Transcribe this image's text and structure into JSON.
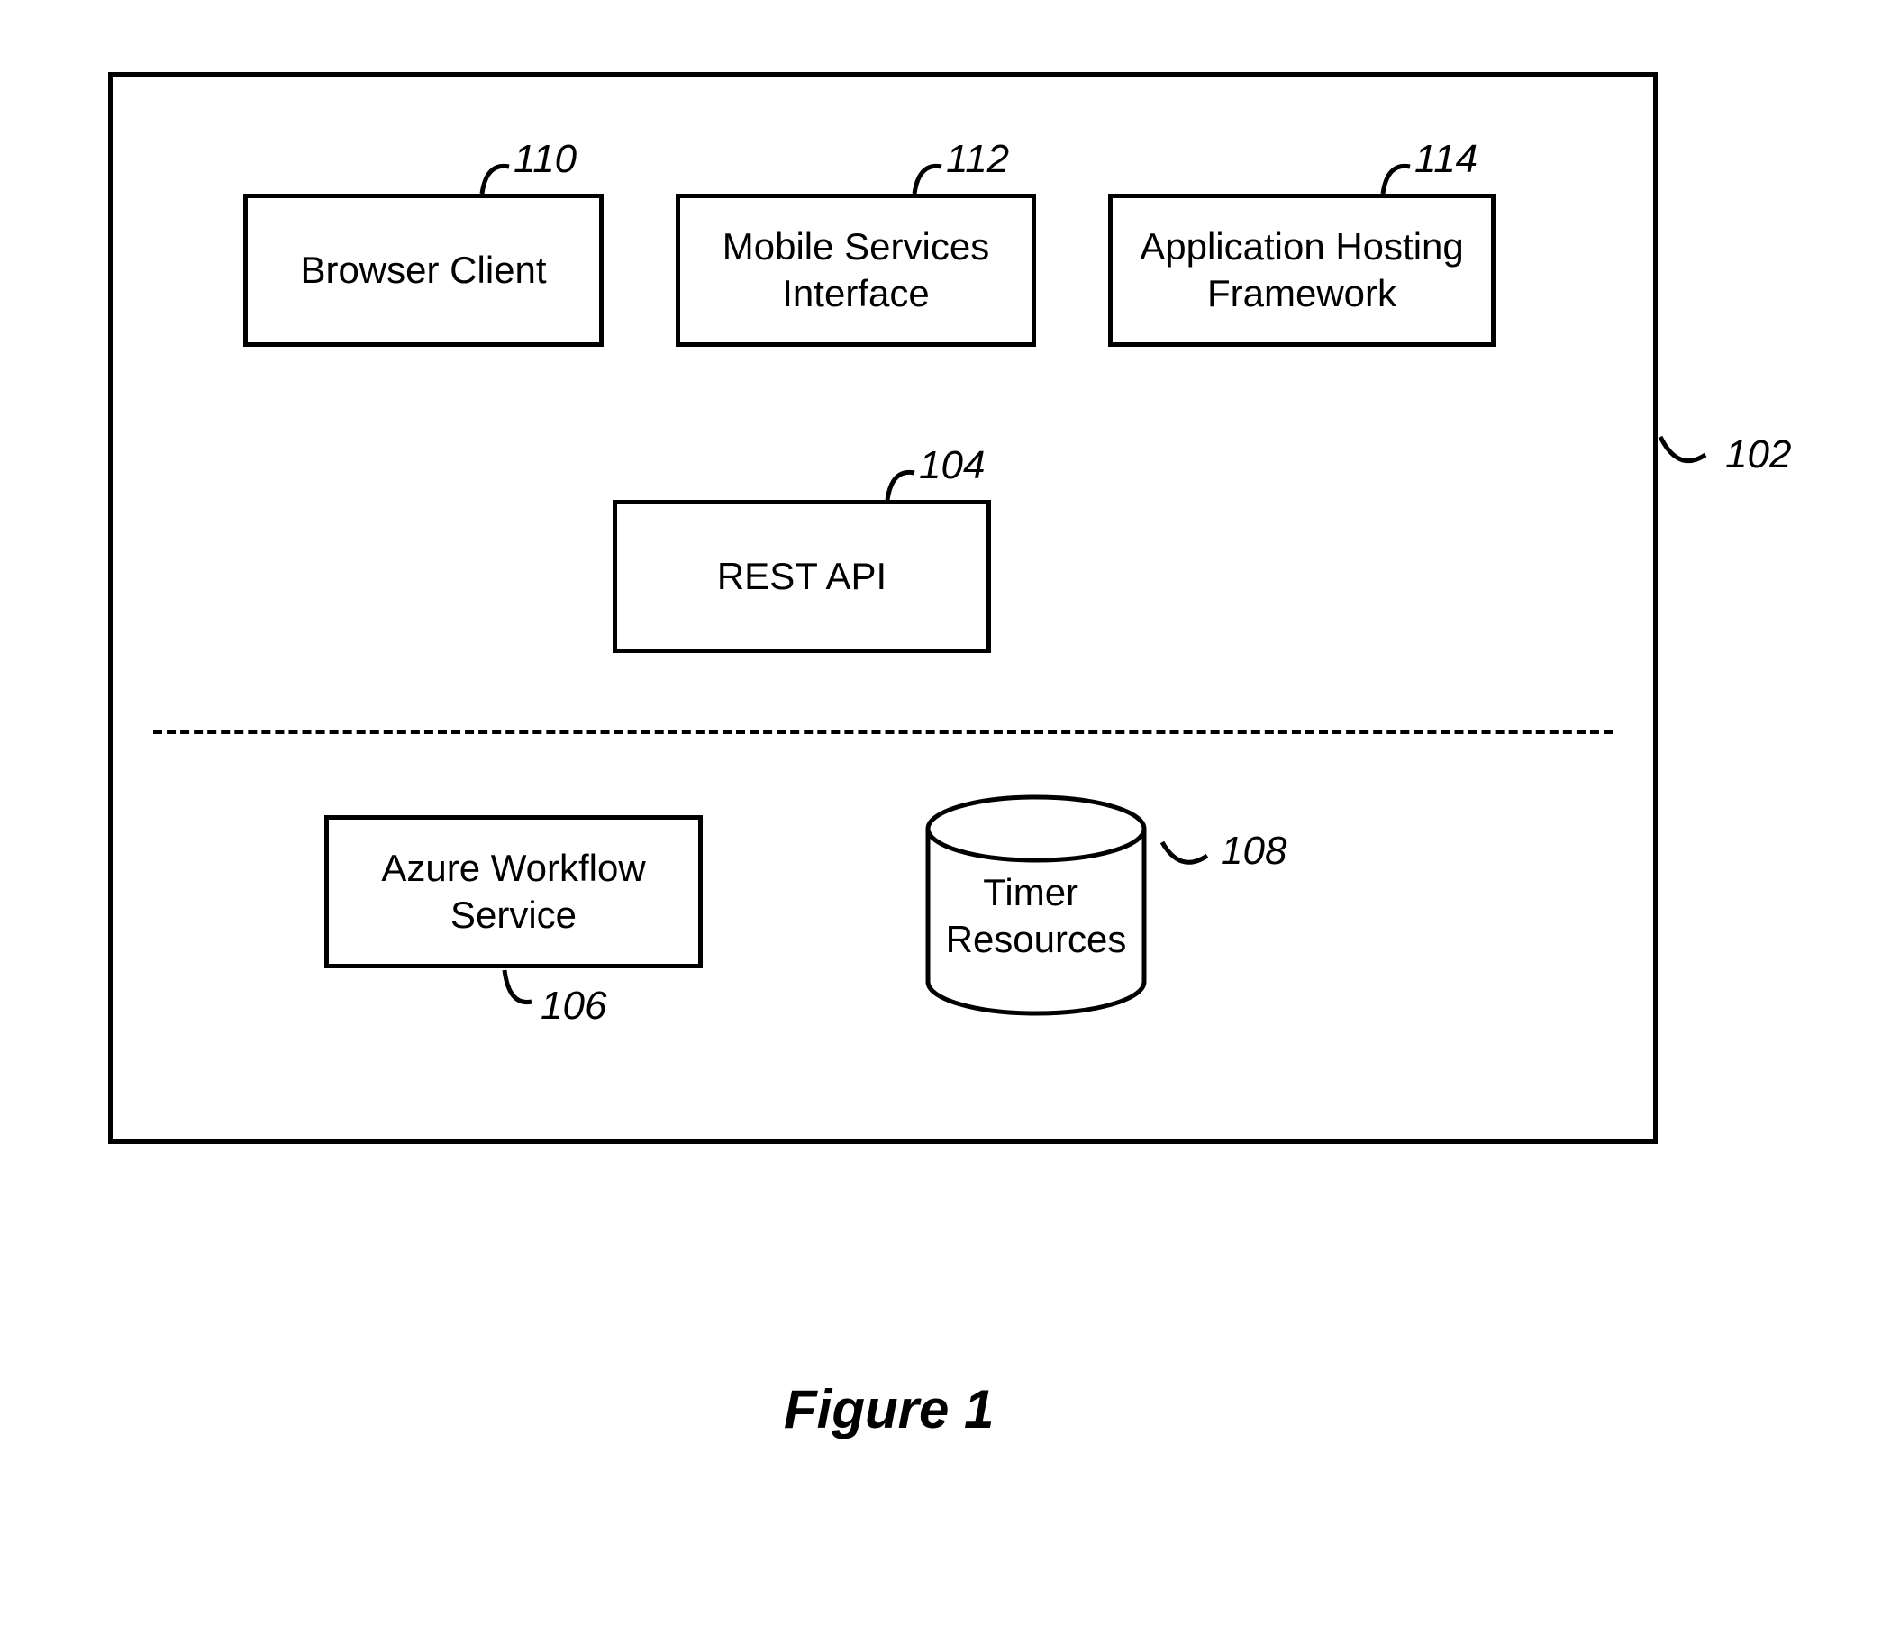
{
  "boxes": {
    "browser_client": {
      "label": "Browser Client",
      "ref": "110"
    },
    "mobile_services": {
      "label": "Mobile Services\nInterface",
      "ref": "112"
    },
    "app_hosting": {
      "label": "Application Hosting\nFramework",
      "ref": "114"
    },
    "rest_api": {
      "label": "REST API",
      "ref": "104"
    },
    "azure_workflow": {
      "label": "Azure Workflow\nService",
      "ref": "106"
    },
    "timer_resources": {
      "label": "Timer\nResources",
      "ref": "108"
    }
  },
  "frame_ref": "102",
  "caption": "Figure 1"
}
